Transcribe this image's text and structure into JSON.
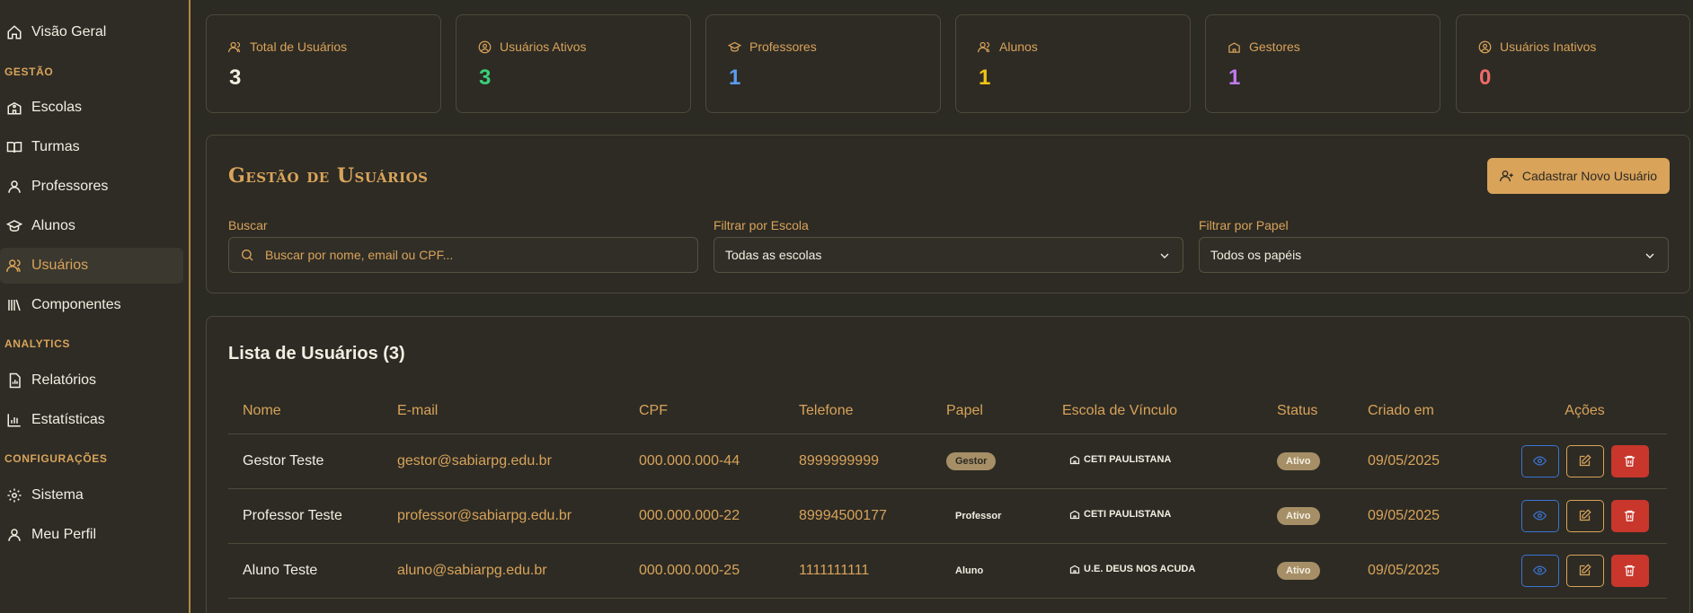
{
  "sidebar": {
    "overview": "Visão Geral",
    "section_gestao": "GESTÃO",
    "escolas": "Escolas",
    "turmas": "Turmas",
    "professores": "Professores",
    "alunos": "Alunos",
    "usuarios": "Usuários",
    "componentes": "Componentes",
    "section_analytics": "ANALYTICS",
    "relatorios": "Relatórios",
    "estatisticas": "Estatísticas",
    "section_config": "CONFIGURAÇÕES",
    "sistema": "Sistema",
    "meu_perfil": "Meu Perfil",
    "active_item": "usuarios"
  },
  "stats": [
    {
      "label": "Total de Usuários",
      "value": "3",
      "color": "#f2eee2",
      "icon": "users-icon"
    },
    {
      "label": "Usuários Ativos",
      "value": "3",
      "color": "#3ad07a",
      "icon": "user-circle-icon"
    },
    {
      "label": "Professores",
      "value": "1",
      "color": "#5b9cf0",
      "icon": "graduation-cap-icon"
    },
    {
      "label": "Alunos",
      "value": "1",
      "color": "#f2c514",
      "icon": "users-icon"
    },
    {
      "label": "Gestores",
      "value": "1",
      "color": "#c17af0",
      "icon": "school-icon"
    },
    {
      "label": "Usuários Inativos",
      "value": "0",
      "color": "#f06a6a",
      "icon": "user-circle-icon"
    }
  ],
  "management": {
    "title": "Gestão de Usuários",
    "new_user_button": "Cadastrar Novo Usuário",
    "search_label": "Buscar",
    "search_placeholder": "Buscar por nome, email ou CPF...",
    "school_filter_label": "Filtrar por Escola",
    "school_filter_value": "Todas as escolas",
    "role_filter_label": "Filtrar por Papel",
    "role_filter_value": "Todos os papéis"
  },
  "list": {
    "title": "Lista de Usuários (3)",
    "columns": [
      "Nome",
      "E-mail",
      "CPF",
      "Telefone",
      "Papel",
      "Escola de Vínculo",
      "Status",
      "Criado em",
      "Ações"
    ],
    "rows": [
      {
        "name": "Gestor Teste",
        "email": "gestor@sabiarpg.edu.br",
        "cpf": "000.000.000-44",
        "phone": "8999999999",
        "role": "Gestor",
        "school": "CETI PAULISTANA",
        "status": "Ativo",
        "created": "09/05/2025"
      },
      {
        "name": "Professor Teste",
        "email": "professor@sabiarpg.edu.br",
        "cpf": "000.000.000-22",
        "phone": "89994500177",
        "role": "Professor",
        "school": "CETI PAULISTANA",
        "status": "Ativo",
        "created": "09/05/2025"
      },
      {
        "name": "Aluno Teste",
        "email": "aluno@sabiarpg.edu.br",
        "cpf": "000.000.000-25",
        "phone": "1111111111",
        "role": "Aluno",
        "school": "U.E. DEUS NOS ACUDA",
        "status": "Ativo",
        "created": "09/05/2025"
      }
    ]
  },
  "colors": {
    "accent": "#d9a35a",
    "background": "#2b2a23",
    "danger": "#c8362c",
    "view": "#3b74d6"
  }
}
